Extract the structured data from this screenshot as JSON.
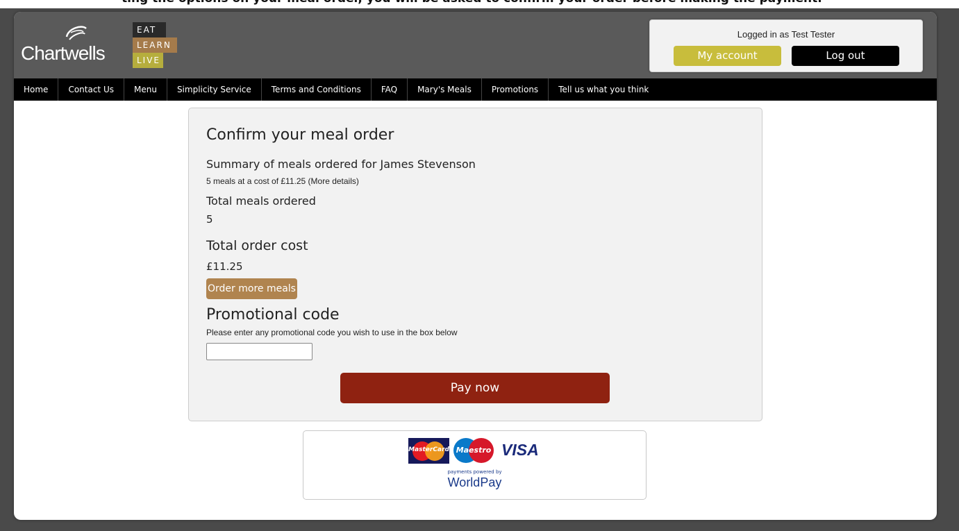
{
  "top_cut_text": "ting the options on your meal order, you will be asked to confirm your order before making the payment.",
  "logo": {
    "word": "Chartwells",
    "tagline": [
      "EAT",
      "LEARN",
      "LIVE"
    ]
  },
  "account": {
    "logged_in_text": "Logged in as Test Tester",
    "my_account_label": "My account",
    "logout_label": "Log out"
  },
  "nav": {
    "items": [
      "Home",
      "Contact Us",
      "Menu",
      "Simplicity Service",
      "Terms and Conditions",
      "FAQ",
      "Mary's Meals",
      "Promotions",
      "Tell us what you think"
    ]
  },
  "order": {
    "title": "Confirm your meal order",
    "summary_title": "Summary of meals ordered for James Stevenson",
    "summary_detail": "5 meals at a cost of £11.25 (More details)",
    "total_meals_label": "Total meals ordered",
    "total_meals_value": "5",
    "total_cost_label": "Total order cost",
    "total_cost_value": "£11.25",
    "order_more_label": "Order more meals",
    "promo_title": "Promotional code",
    "promo_help": "Please enter any promotional code you wish to use in the box below",
    "promo_value": "",
    "pay_label": "Pay now"
  },
  "payment": {
    "mastercard_text": "MasterCard",
    "maestro_text": "Maestro",
    "visa_text": "VISA",
    "powered_by": "payments powered by",
    "provider": "WorldPay"
  },
  "colors": {
    "header_bg": "#5a5a5a",
    "nav_bg": "#000000",
    "account_button": "#c8bd3c",
    "order_more_button": "#b0844f",
    "pay_button": "#8f2211"
  }
}
